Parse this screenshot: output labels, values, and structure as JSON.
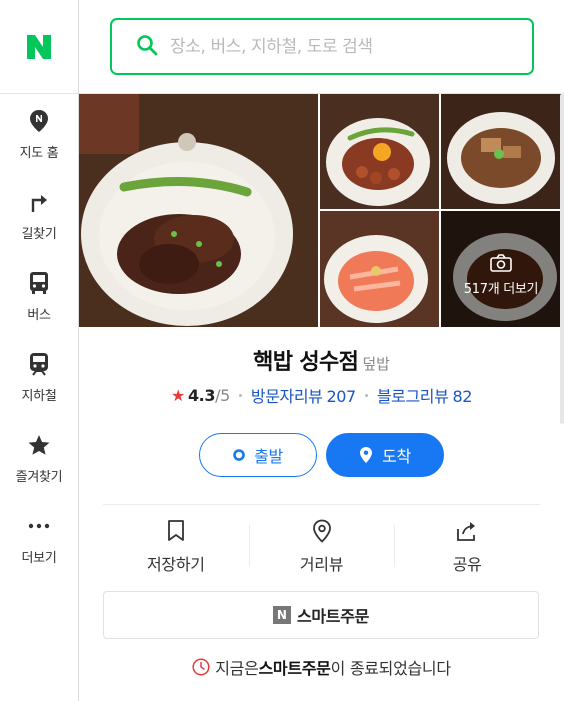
{
  "app": {
    "brand_color": "#03c75a",
    "accent_color": "#1877f2"
  },
  "search": {
    "placeholder": "장소, 버스, 지하철, 도로 검색",
    "value": ""
  },
  "sidebar": {
    "items": [
      {
        "label": "지도 홈",
        "icon": "map-pin-icon"
      },
      {
        "label": "길찾기",
        "icon": "turn-right-icon"
      },
      {
        "label": "버스",
        "icon": "bus-icon"
      },
      {
        "label": "지하철",
        "icon": "subway-icon"
      },
      {
        "label": "즐겨찾기",
        "icon": "star-icon"
      },
      {
        "label": "더보기",
        "icon": "more-dots-icon"
      }
    ]
  },
  "place": {
    "photos_more_label": "517개 더보기",
    "name": "핵밥 성수점",
    "category": "덮밥",
    "rating": "4.3",
    "rating_max": "/5",
    "visitor_review_label": "방문자리뷰",
    "visitor_review_count": "207",
    "blog_review_label": "블로그리뷰",
    "blog_review_count": "82",
    "start_label": "출발",
    "arrive_label": "도착",
    "actions": [
      {
        "label": "저장하기",
        "icon": "bookmark-icon"
      },
      {
        "label": "거리뷰",
        "icon": "street-view-pin-icon"
      },
      {
        "label": "공유",
        "icon": "share-icon"
      }
    ],
    "smart_order_badge": "N",
    "smart_order_label": "스마트주문",
    "notice_prefix": "지금은 ",
    "notice_bold": "스마트주문",
    "notice_suffix": "이 종료되었습니다"
  }
}
